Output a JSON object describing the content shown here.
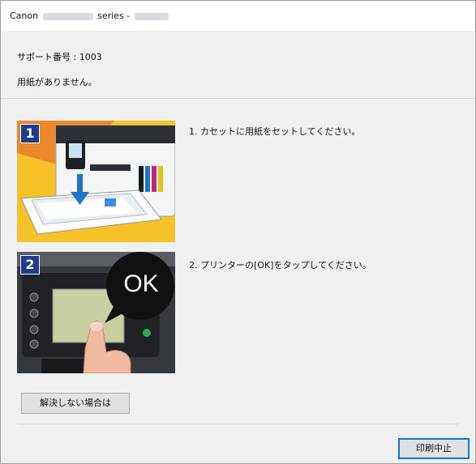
{
  "window": {
    "title_prefix": "Canon",
    "title_middle": "series -"
  },
  "dialog": {
    "support_code": "サポート番号 : 1003",
    "message": "用紙がありません。"
  },
  "steps": [
    {
      "number": "1",
      "text": "1.  カセットに用紙をセットしてください。"
    },
    {
      "number": "2",
      "text": "2.  プリンターの[OK]をタップしてください。",
      "bubble": "OK"
    }
  ],
  "buttons": {
    "help": "解決しない場合は",
    "cancel": "印刷中止"
  },
  "colors": {
    "badge": "#1d3c89",
    "step1_bg": "#f6c228",
    "focus_border": "#0078d7"
  }
}
